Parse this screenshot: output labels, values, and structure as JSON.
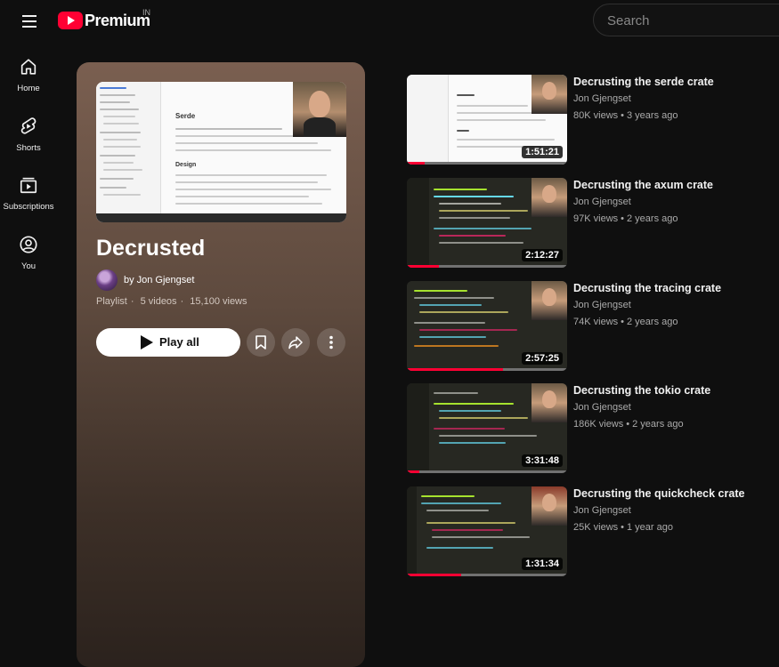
{
  "header": {
    "brand": "Premium",
    "region": "IN",
    "search_placeholder": "Search"
  },
  "nav": {
    "items": [
      {
        "label": "Home",
        "icon": "home-icon"
      },
      {
        "label": "Shorts",
        "icon": "shorts-icon"
      },
      {
        "label": "Subscriptions",
        "icon": "subscriptions-icon"
      },
      {
        "label": "You",
        "icon": "you-icon"
      }
    ]
  },
  "playlist": {
    "title": "Decrusted",
    "by": "by",
    "owner": "Jon Gjengset",
    "type": "Playlist",
    "video_count": "5 videos",
    "views": "15,100 views",
    "play_all": "Play all",
    "hero_doc_heading": "Serde",
    "hero_doc_subheading": "Design"
  },
  "videos": [
    {
      "title": "Decrusting the serde crate",
      "channel": "Jon Gjengset",
      "views": "80K views",
      "age": "3 years ago",
      "duration": "1:51:21",
      "watched": 0.11,
      "thumb_style": "doc"
    },
    {
      "title": "Decrusting the axum crate",
      "channel": "Jon Gjengset",
      "views": "97K views",
      "age": "2 years ago",
      "duration": "2:12:27",
      "watched": 0.2,
      "thumb_style": "code"
    },
    {
      "title": "Decrusting the tracing crate",
      "channel": "Jon Gjengset",
      "views": "74K views",
      "age": "2 years ago",
      "duration": "2:57:25",
      "watched": 0.6,
      "thumb_style": "code"
    },
    {
      "title": "Decrusting the tokio crate",
      "channel": "Jon Gjengset",
      "views": "186K views",
      "age": "2 years ago",
      "duration": "3:31:48",
      "watched": 0.08,
      "thumb_style": "code"
    },
    {
      "title": "Decrusting the quickcheck crate",
      "channel": "Jon Gjengset",
      "views": "25K views",
      "age": "1 year ago",
      "duration": "1:31:34",
      "watched": 0.34,
      "thumb_style": "code"
    }
  ],
  "colors": {
    "accent": "#ff0033",
    "background": "#0f0f0f",
    "panel_top": "#7a5f50",
    "panel_bottom": "#2b221d"
  }
}
